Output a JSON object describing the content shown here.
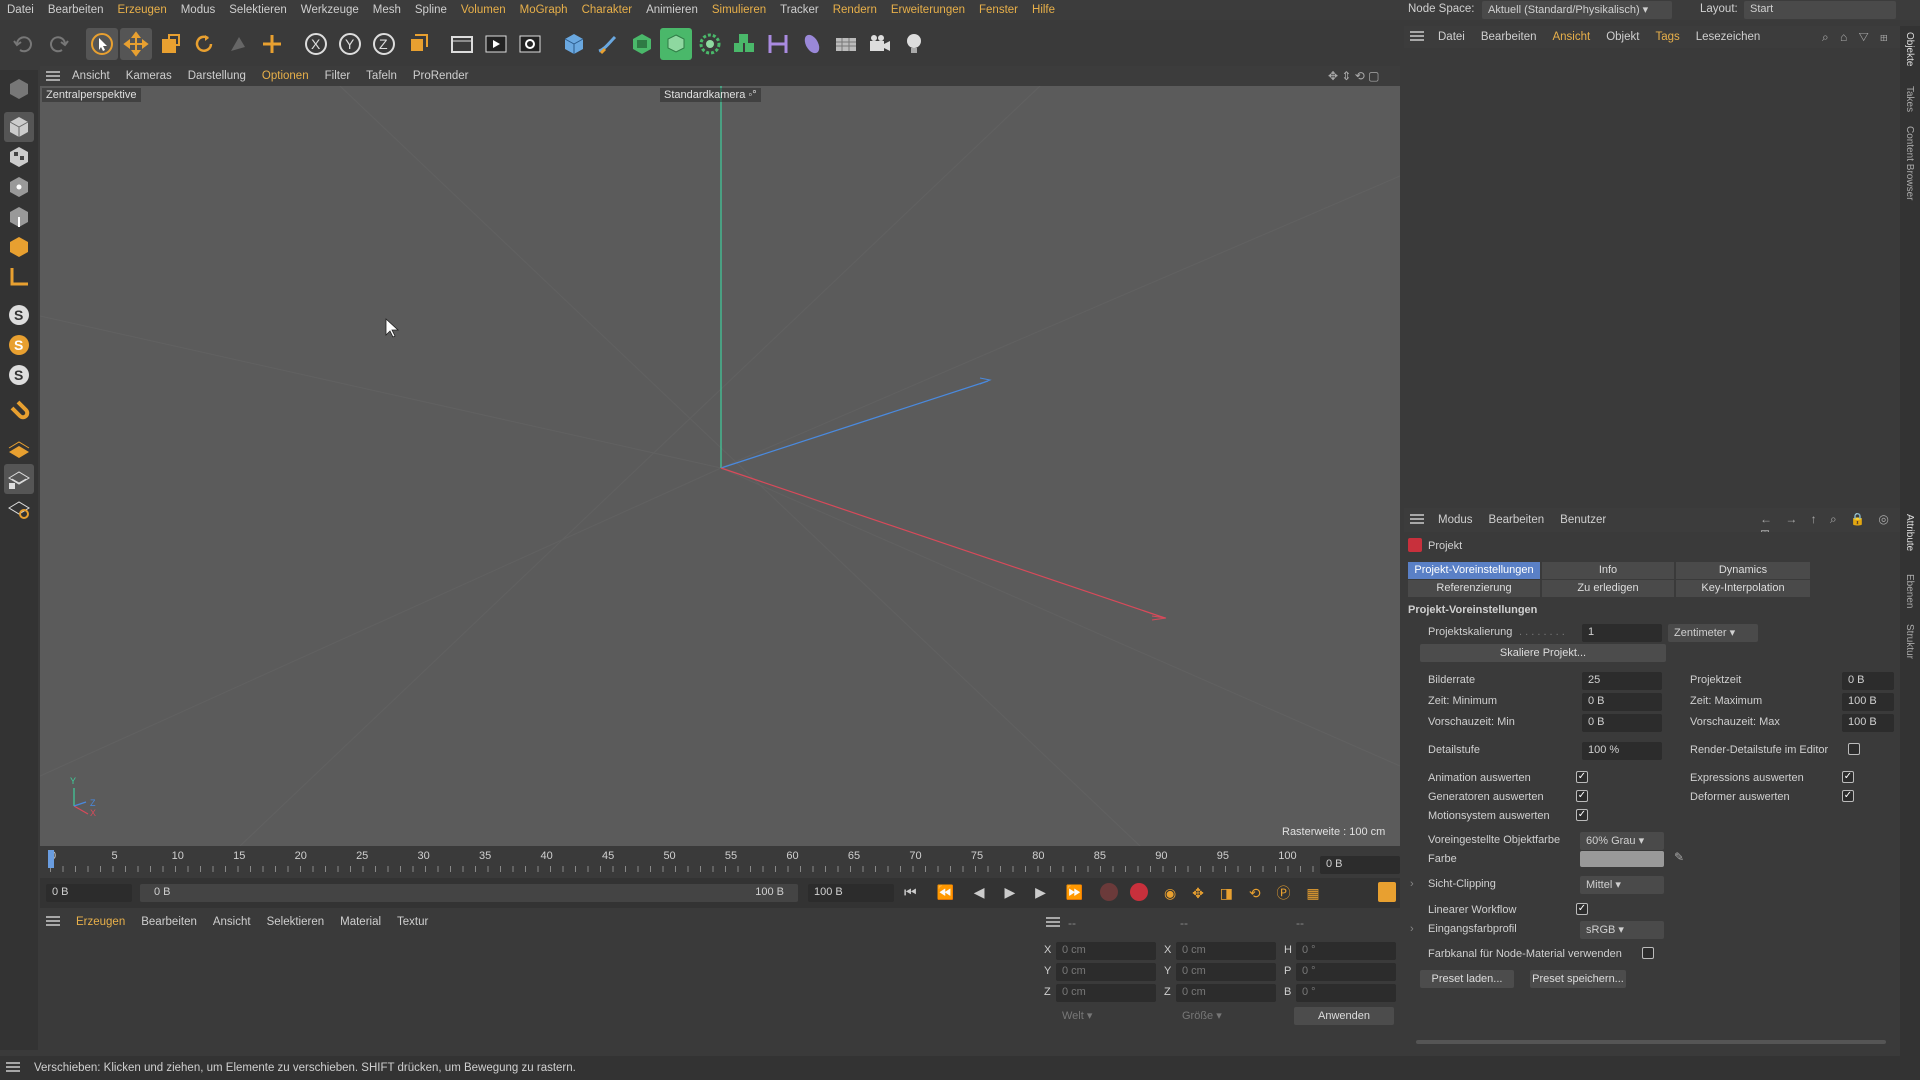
{
  "menu": [
    "Datei",
    "Bearbeiten",
    "Erzeugen",
    "Modus",
    "Selektieren",
    "Werkzeuge",
    "Mesh",
    "Spline",
    "Volumen",
    "MoGraph",
    "Charakter",
    "Animieren",
    "Simulieren",
    "Tracker",
    "Rendern",
    "Erweiterungen",
    "Fenster",
    "Hilfe"
  ],
  "nodespace": {
    "label": "Node Space:",
    "value": "Aktuell (Standard/Physikalisch)",
    "layout_label": "Layout:",
    "layout_value": "Start"
  },
  "viewport": {
    "menu": [
      "Ansicht",
      "Kameras",
      "Darstellung",
      "Optionen",
      "Filter",
      "Tafeln",
      "ProRender"
    ],
    "projection": "Zentralperspektive",
    "camera": "Standardkamera",
    "grid": "Rasterweite : 100 cm",
    "axis_y": "Y",
    "axis_z": "Z",
    "axis_x": "X"
  },
  "timeline": {
    "ticks": [
      "0",
      "5",
      "10",
      "15",
      "20",
      "25",
      "30",
      "35",
      "40",
      "45",
      "50",
      "55",
      "60",
      "65",
      "70",
      "75",
      "80",
      "85",
      "90",
      "95",
      "100"
    ],
    "current": "0 B",
    "start": "0 B",
    "range_start": "0 B",
    "range_end": "100 B",
    "end": "100 B"
  },
  "material": {
    "menu": [
      "Erzeugen",
      "Bearbeiten",
      "Ansicht",
      "Selektieren",
      "Material",
      "Textur"
    ]
  },
  "coords": {
    "head": [
      "--",
      "--",
      "--"
    ],
    "rows": [
      {
        "a": "X",
        "av": "0 cm",
        "b": "X",
        "bv": "0 cm",
        "c": "H",
        "cv": "0 °"
      },
      {
        "a": "Y",
        "av": "0 cm",
        "b": "Y",
        "bv": "0 cm",
        "c": "P",
        "cv": "0 °"
      },
      {
        "a": "Z",
        "av": "0 cm",
        "b": "Z",
        "bv": "0 cm",
        "c": "B",
        "cv": "0 °"
      }
    ],
    "world": "Welt",
    "size": "Größe",
    "apply": "Anwenden"
  },
  "objmgr": {
    "menu": [
      "Datei",
      "Bearbeiten",
      "Ansicht",
      "Objekt",
      "Tags",
      "Lesezeichen"
    ]
  },
  "vtabs": {
    "top": [
      "Objekte",
      "Takes",
      "Content Browser"
    ],
    "bottom": [
      "Attribute",
      "Ebenen",
      "Struktur"
    ]
  },
  "attr": {
    "menu": [
      "Modus",
      "Bearbeiten",
      "Benutzer"
    ],
    "title": "Projekt",
    "tabs": [
      "Projekt-Voreinstellungen",
      "Info",
      "Dynamics",
      "Referenzierung",
      "Zu erledigen",
      "Key-Interpolation"
    ],
    "section": "Projekt-Voreinstellungen",
    "scale_label": "Projektskalierung",
    "scale_value": "1",
    "scale_unit": "Zentimeter",
    "scale_btn": "Skaliere Projekt...",
    "fps_label": "Bilderrate",
    "fps": "25",
    "ptime_label": "Projektzeit",
    "ptime": "0 B",
    "tmin_label": "Zeit: Minimum",
    "tmin": "0 B",
    "tmax_label": "Zeit: Maximum",
    "tmax": "100 B",
    "pmin_label": "Vorschauzeit: Min",
    "pmin": "0 B",
    "pmax_label": "Vorschauzeit: Max",
    "pmax": "100 B",
    "lod_label": "Detailstufe",
    "lod": "100 %",
    "rlod_label": "Render-Detailstufe im Editor",
    "anim_label": "Animation auswerten",
    "expr_label": "Expressions auswerten",
    "gen_label": "Generatoren auswerten",
    "def_label": "Deformer auswerten",
    "motion_label": "Motionsystem auswerten",
    "objcolor_label": "Voreingestellte Objektfarbe",
    "objcolor": "60% Grau",
    "color_label": "Farbe",
    "clip_label": "Sicht-Clipping",
    "clip": "Mittel",
    "linear_label": "Linearer Workflow",
    "profile_label": "Eingangsfarbprofil",
    "profile": "sRGB",
    "node_label": "Farbkanal für Node-Material verwenden",
    "load": "Preset laden...",
    "save": "Preset speichern..."
  },
  "status": "Verschieben: Klicken und ziehen, um Elemente zu verschieben. SHIFT drücken, um Bewegung zu rastern."
}
